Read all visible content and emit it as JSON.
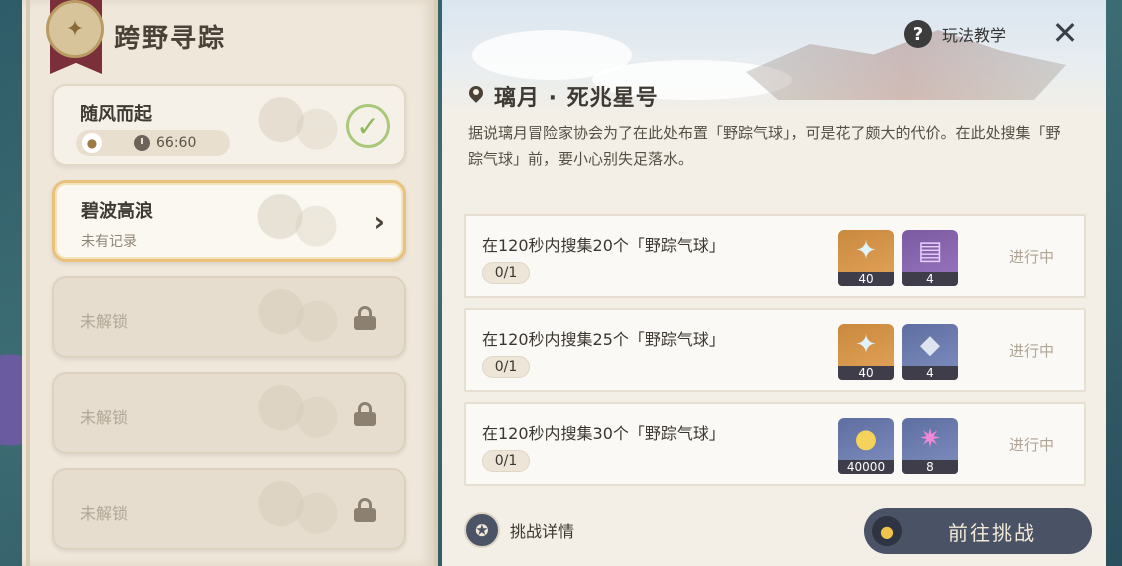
{
  "header": {
    "title": "跨野寻踪"
  },
  "left": {
    "cards": [
      {
        "title": "随风而起",
        "time": "66:60",
        "status": "completed"
      },
      {
        "title": "碧波高浪",
        "subtitle": "未有记录",
        "status": "selected"
      },
      {
        "title": "未解锁",
        "status": "locked"
      },
      {
        "title": "未解锁",
        "status": "locked"
      },
      {
        "title": "未解锁",
        "status": "locked"
      }
    ]
  },
  "right": {
    "help_label": "玩法教学",
    "location": "璃月 · 死兆星号",
    "description": "据说璃月冒险家协会为了在此处布置「野踪气球」，可是花了颇大的代价。在此处搜集「野踪气球」前，要小心别失足落水。",
    "tasks": [
      {
        "title": "在120秒内搜集20个「野踪气球」",
        "progress": "0/1",
        "status": "进行中",
        "rewards": [
          {
            "icon": "primogem-icon",
            "count": "40"
          },
          {
            "icon": "purple-book-icon",
            "count": "4"
          }
        ]
      },
      {
        "title": "在120秒内搜集25个「野踪气球」",
        "progress": "0/1",
        "status": "进行中",
        "rewards": [
          {
            "icon": "primogem-icon",
            "count": "40"
          },
          {
            "icon": "ore-icon",
            "count": "4"
          }
        ]
      },
      {
        "title": "在120秒内搜集30个「野踪气球」",
        "progress": "0/1",
        "status": "进行中",
        "rewards": [
          {
            "icon": "mora-coin-icon",
            "count": "40000"
          },
          {
            "icon": "crystal-icon",
            "count": "8"
          }
        ]
      }
    ],
    "detail_label": "挑战详情",
    "go_label": "前往挑战"
  },
  "colors": {
    "accent_gold": "#e8c27a",
    "button_dark": "#4a5266",
    "check_green": "#8fb85a"
  }
}
